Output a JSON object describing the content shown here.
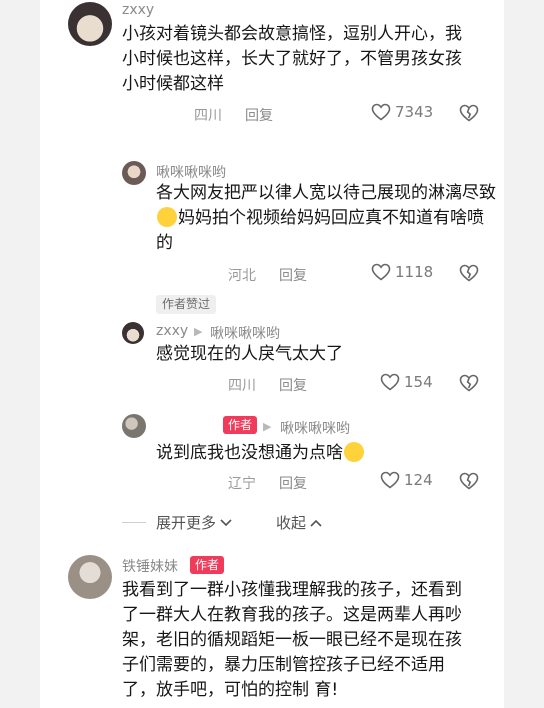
{
  "comments": [
    {
      "username": "zxxy",
      "text": "小孩对着镜头都会故意搞怪，逗别人开心，我小时候也这样，长大了就好了，不管男孩女孩小时候都这样",
      "location": "四川",
      "reply_label": "回复",
      "likes": "7343"
    },
    {
      "username": "啾咪啾咪哟",
      "text_before_emoji": "各大网友把严以律人宽以待己展现的淋漓尽致",
      "text_after_emoji": "妈妈拍个视频给妈妈回应真不知道有啥喷的",
      "location": "河北",
      "reply_label": "回复",
      "likes": "1118",
      "author_liked_tag": "作者赞过"
    },
    {
      "username": "zxxy",
      "reply_to": "啾咪啾咪哟",
      "text": "感觉现在的人戾气太大了",
      "location": "四川",
      "reply_label": "回复",
      "likes": "154"
    },
    {
      "username": "",
      "author_badge": "作者",
      "reply_to": "啾咪啾咪哟",
      "text": "说到底我也没想通为点啥",
      "location": "辽宁",
      "reply_label": "回复",
      "likes": "124"
    },
    {
      "username": "铁锤妹妹",
      "author_badge": "作者",
      "text": "我看到了一群小孩懂我理解我的孩子，还看到了一群大人在教育我的孩子。这是两辈人再吵架，老旧的循规蹈矩一板一眼已经不是现在孩子们需要的，暴力压制管控孩子已经不适用了，放手吧，可怕的控制 育!"
    }
  ],
  "thread_controls": {
    "expand_more": "展开更多",
    "collapse": "收起"
  },
  "icons": {
    "like": "heart-outline-icon",
    "dislike": "broken-heart-icon",
    "expand": "chevron-down-icon",
    "collapse": "chevron-up-icon",
    "reply_arrow": "triangle-right-icon"
  },
  "colors": {
    "badge": "#f03c5a",
    "emoji": "#ffd23c"
  }
}
